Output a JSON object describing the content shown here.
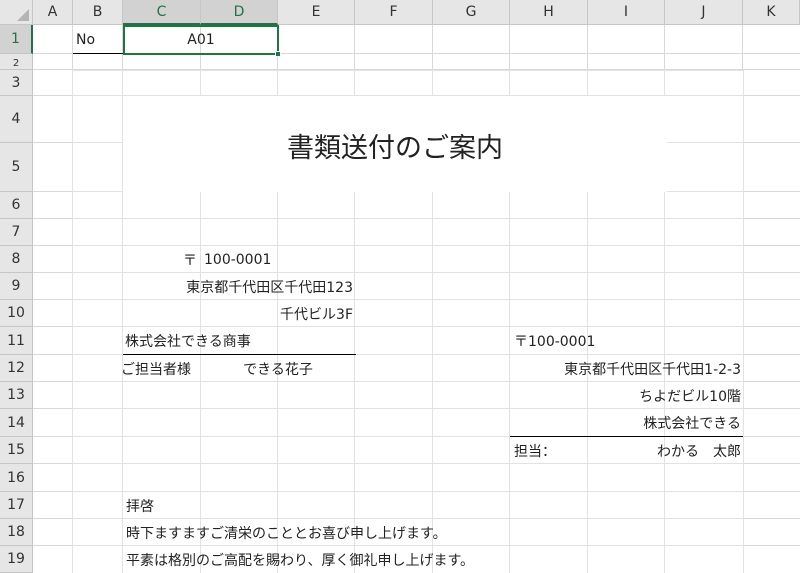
{
  "columns": [
    "A",
    "B",
    "C",
    "D",
    "E",
    "F",
    "G",
    "H",
    "I",
    "J",
    "K"
  ],
  "rows": [
    "1",
    "2",
    "3",
    "4",
    "5",
    "6",
    "7",
    "8",
    "9",
    "10",
    "11",
    "12",
    "13",
    "14",
    "15",
    "16",
    "17",
    "18",
    "19"
  ],
  "cells": {
    "b1": "No",
    "cd1": "A01",
    "title": "書類送付のご案内",
    "postal_mark_r8": "〒",
    "postal_r8": "100-0001",
    "addr_r9": "東京都千代田区千代田123",
    "building_r10": "千代ビル3F",
    "company_r11": "株式会社できる商事",
    "honorific_r12": "ご担当者様",
    "recipient_r12": "できる花子",
    "sender_postal_r11": "〒100-0001",
    "sender_addr_r12": "東京都千代田区千代田1-2-3",
    "sender_building_r13": "ちよだビル10階",
    "sender_company_r14": "株式会社できる",
    "contact_label_r15": "担当：",
    "contact_name_r15": "わかる　太郎",
    "greeting_r17": "拝啓",
    "line_r18": "時下ますますご清栄のこととお喜び申し上げます。",
    "line_r19": "平素は格別のご高配を賜わり、厚く御礼申し上げます。"
  }
}
